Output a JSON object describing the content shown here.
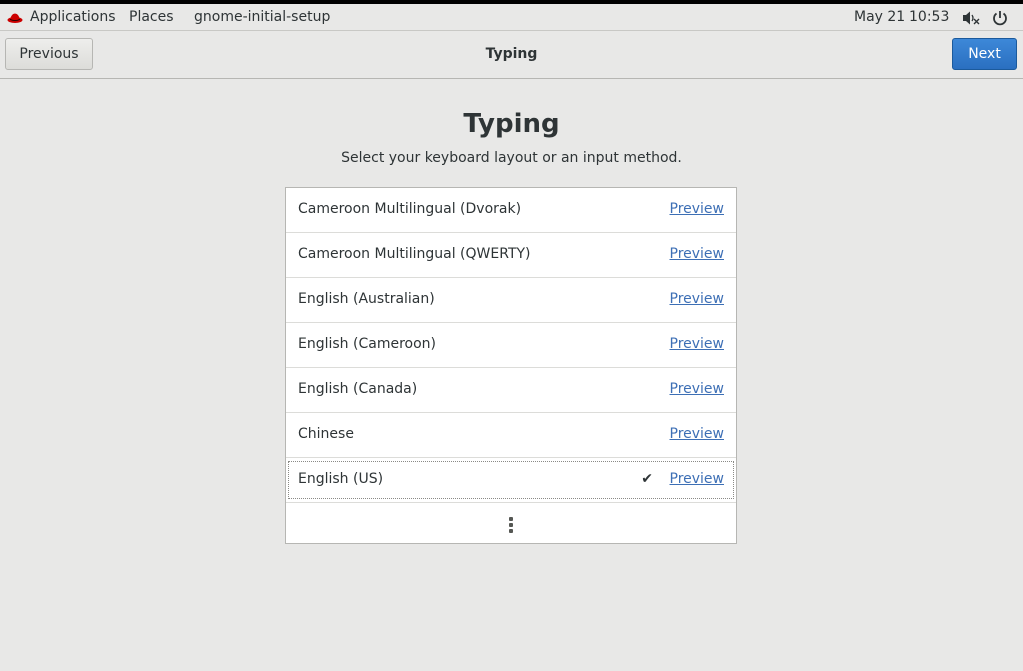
{
  "topbar": {
    "applications": "Applications",
    "places": "Places",
    "app_name": "gnome-initial-setup",
    "date": "May 21",
    "time": "10:53",
    "brand_color": "#cc0000"
  },
  "header": {
    "previous_label": "Previous",
    "title": "Typing",
    "next_label": "Next",
    "next_color": "#2f7bd0"
  },
  "content": {
    "title": "Typing",
    "subtitle": "Select your keyboard layout or an input method.",
    "layouts": [
      {
        "label": "Cameroon Multilingual (Dvorak)",
        "preview": "Preview",
        "selected": false
      },
      {
        "label": "Cameroon Multilingual (QWERTY)",
        "preview": "Preview",
        "selected": false
      },
      {
        "label": "English (Australian)",
        "preview": "Preview",
        "selected": false
      },
      {
        "label": "English (Cameroon)",
        "preview": "Preview",
        "selected": false
      },
      {
        "label": "English (Canada)",
        "preview": "Preview",
        "selected": false
      },
      {
        "label": "Chinese",
        "preview": "Preview",
        "selected": false
      },
      {
        "label": "English (US)",
        "preview": "Preview",
        "selected": true
      }
    ],
    "more_icon": "view-more-icon"
  }
}
